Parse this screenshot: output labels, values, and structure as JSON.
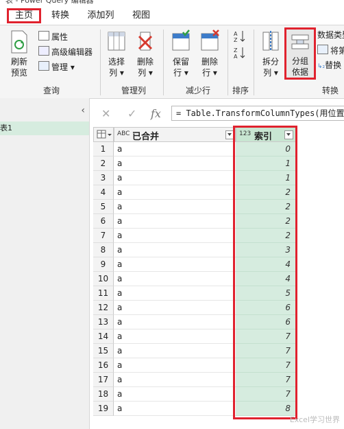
{
  "window": {
    "title_fragment": "表 - Power Query 编辑器"
  },
  "tabs": [
    {
      "label": "主页",
      "active": true
    },
    {
      "label": "转换"
    },
    {
      "label": "添加列"
    },
    {
      "label": "视图"
    }
  ],
  "ribbon": {
    "refresh": {
      "line1": "刷新",
      "line2": "预览"
    },
    "properties": "属性",
    "advanced_editor": "高级编辑器",
    "manage": "管理",
    "query_group": "查询",
    "choose_columns": {
      "line1": "选择",
      "line2": "列"
    },
    "remove_columns": {
      "line1": "删除",
      "line2": "列"
    },
    "manage_columns_group": "管理列",
    "keep_rows": {
      "line1": "保留",
      "line2": "行"
    },
    "remove_rows": {
      "line1": "删除",
      "line2": "行"
    },
    "reduce_rows_group": "减少行",
    "sort_group": "排序",
    "split_column": {
      "line1": "拆分",
      "line2": "列"
    },
    "group_by": {
      "line1": "分组",
      "line2": "依据"
    },
    "data_type": "数据类型",
    "use_first_row": "将第",
    "replace_values": "替换",
    "transform_group": "转换"
  },
  "queries_pane": {
    "collapse_glyph": "‹",
    "selected_query": "表1"
  },
  "formula_bar": {
    "cancel": "✕",
    "confirm": "✓",
    "fx": "fx",
    "text": "= Table.TransformColumnTypes(用位置分列"
  },
  "grid": {
    "columns": [
      {
        "type_icon": "ABC",
        "name": "已合并"
      },
      {
        "type_icon": "123",
        "name": "索引"
      }
    ],
    "rows": [
      {
        "num": "1",
        "merged": "a",
        "index": "0"
      },
      {
        "num": "2",
        "merged": "a",
        "index": "1"
      },
      {
        "num": "3",
        "merged": "a",
        "index": "1"
      },
      {
        "num": "4",
        "merged": "a",
        "index": "2"
      },
      {
        "num": "5",
        "merged": "a",
        "index": "2"
      },
      {
        "num": "6",
        "merged": "a",
        "index": "2"
      },
      {
        "num": "7",
        "merged": "a",
        "index": "2"
      },
      {
        "num": "8",
        "merged": "a",
        "index": "3"
      },
      {
        "num": "9",
        "merged": "a",
        "index": "4"
      },
      {
        "num": "10",
        "merged": "a",
        "index": "4"
      },
      {
        "num": "11",
        "merged": "a",
        "index": "5"
      },
      {
        "num": "12",
        "merged": "a",
        "index": "6"
      },
      {
        "num": "13",
        "merged": "a",
        "index": "6"
      },
      {
        "num": "14",
        "merged": "a",
        "index": "7"
      },
      {
        "num": "15",
        "merged": "a",
        "index": "7"
      },
      {
        "num": "16",
        "merged": "a",
        "index": "7"
      },
      {
        "num": "17",
        "merged": "a",
        "index": "7"
      },
      {
        "num": "18",
        "merged": "a",
        "index": "7"
      },
      {
        "num": "19",
        "merged": "a",
        "index": "8"
      }
    ]
  },
  "watermark": "Excel学习世界",
  "colors": {
    "accent_red": "#e0222e",
    "index_fill": "#d6ecdf",
    "ribbon_bg": "#f5f5f5"
  }
}
